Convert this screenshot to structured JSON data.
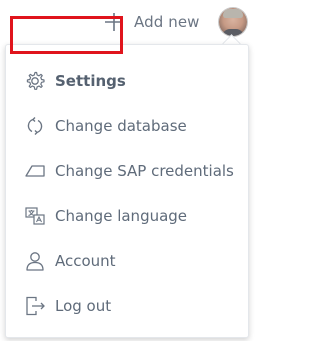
{
  "topbar": {
    "add_new_label": "Add new",
    "add_icon": "plus-icon",
    "avatar_icon": "user-avatar"
  },
  "menu": {
    "items": [
      {
        "label": "Settings",
        "icon": "gear-icon",
        "selected": true
      },
      {
        "label": "Change database",
        "icon": "refresh-icon"
      },
      {
        "label": "Change SAP credentials",
        "icon": "credential-tag-icon"
      },
      {
        "label": "Change language",
        "icon": "translate-icon"
      },
      {
        "label": "Account",
        "icon": "user-icon"
      },
      {
        "label": "Log out",
        "icon": "logout-icon"
      }
    ]
  },
  "colors": {
    "highlight_border": "#e0141c",
    "text": "#5f6b7a"
  }
}
